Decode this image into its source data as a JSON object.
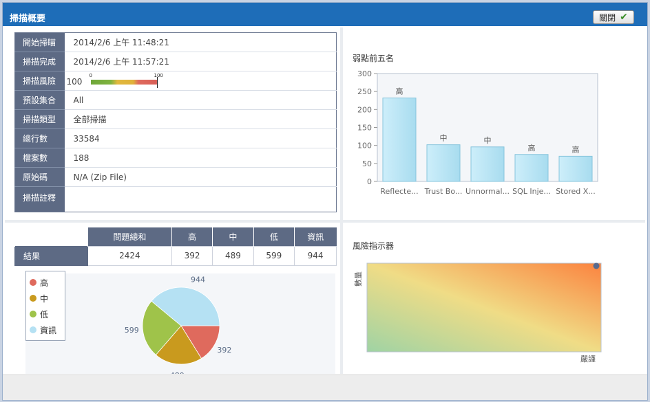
{
  "window": {
    "title": "掃描概要"
  },
  "scan_info": {
    "rows": [
      {
        "key": "開始掃瞄",
        "value": "2014/2/6 上午 11:48:21"
      },
      {
        "key": "掃描完成",
        "value": "2014/2/6 上午 11:57:21"
      },
      {
        "key": "掃描風險",
        "value": "100"
      },
      {
        "key": "預設集合",
        "value": "All"
      },
      {
        "key": "掃描類型",
        "value": "全部掃描"
      },
      {
        "key": "總行數",
        "value": "33584"
      },
      {
        "key": "檔案數",
        "value": "188"
      },
      {
        "key": "原始碼",
        "value": "N/A (Zip File)"
      },
      {
        "key": "掃描註釋",
        "value": ""
      }
    ],
    "risk_scale": {
      "min": "0",
      "max": "100",
      "value": 100
    }
  },
  "results": {
    "headers": [
      "問題總和",
      "高",
      "中",
      "低",
      "資訊"
    ],
    "row_label": "結果",
    "values": [
      "2424",
      "392",
      "489",
      "599",
      "944"
    ]
  },
  "top_vulns": {
    "title": "弱點前五名"
  },
  "risk_indicator": {
    "title": "風險指示器",
    "y_label": "數量",
    "x_label": "嚴謹"
  },
  "footer": {
    "close_label": "關閉"
  },
  "colors": {
    "header_blue": "#1e6db8",
    "label_bg": "#5d6a84",
    "high": "#df6a5d",
    "medium": "#c99a1e",
    "low": "#9fc34a",
    "info": "#b5e1f3",
    "bar": "#bfe7f6"
  },
  "chart_data": [
    {
      "type": "bar",
      "title": "弱點前五名",
      "categories": [
        "Reflecte...",
        "Trust Bo...",
        "Unnormal...",
        "SQL Inje...",
        "Stored X..."
      ],
      "values": [
        232,
        102,
        96,
        75,
        70
      ],
      "data_labels": [
        "高",
        "中",
        "中",
        "高",
        "高"
      ],
      "ylim": [
        0,
        300
      ],
      "yticks": [
        0,
        50,
        100,
        150,
        200,
        250,
        300
      ],
      "grid": false
    },
    {
      "type": "pie",
      "labels": [
        "高",
        "中",
        "低",
        "資訊"
      ],
      "values": [
        392,
        489,
        599,
        944
      ],
      "legend_position": "left"
    }
  ]
}
